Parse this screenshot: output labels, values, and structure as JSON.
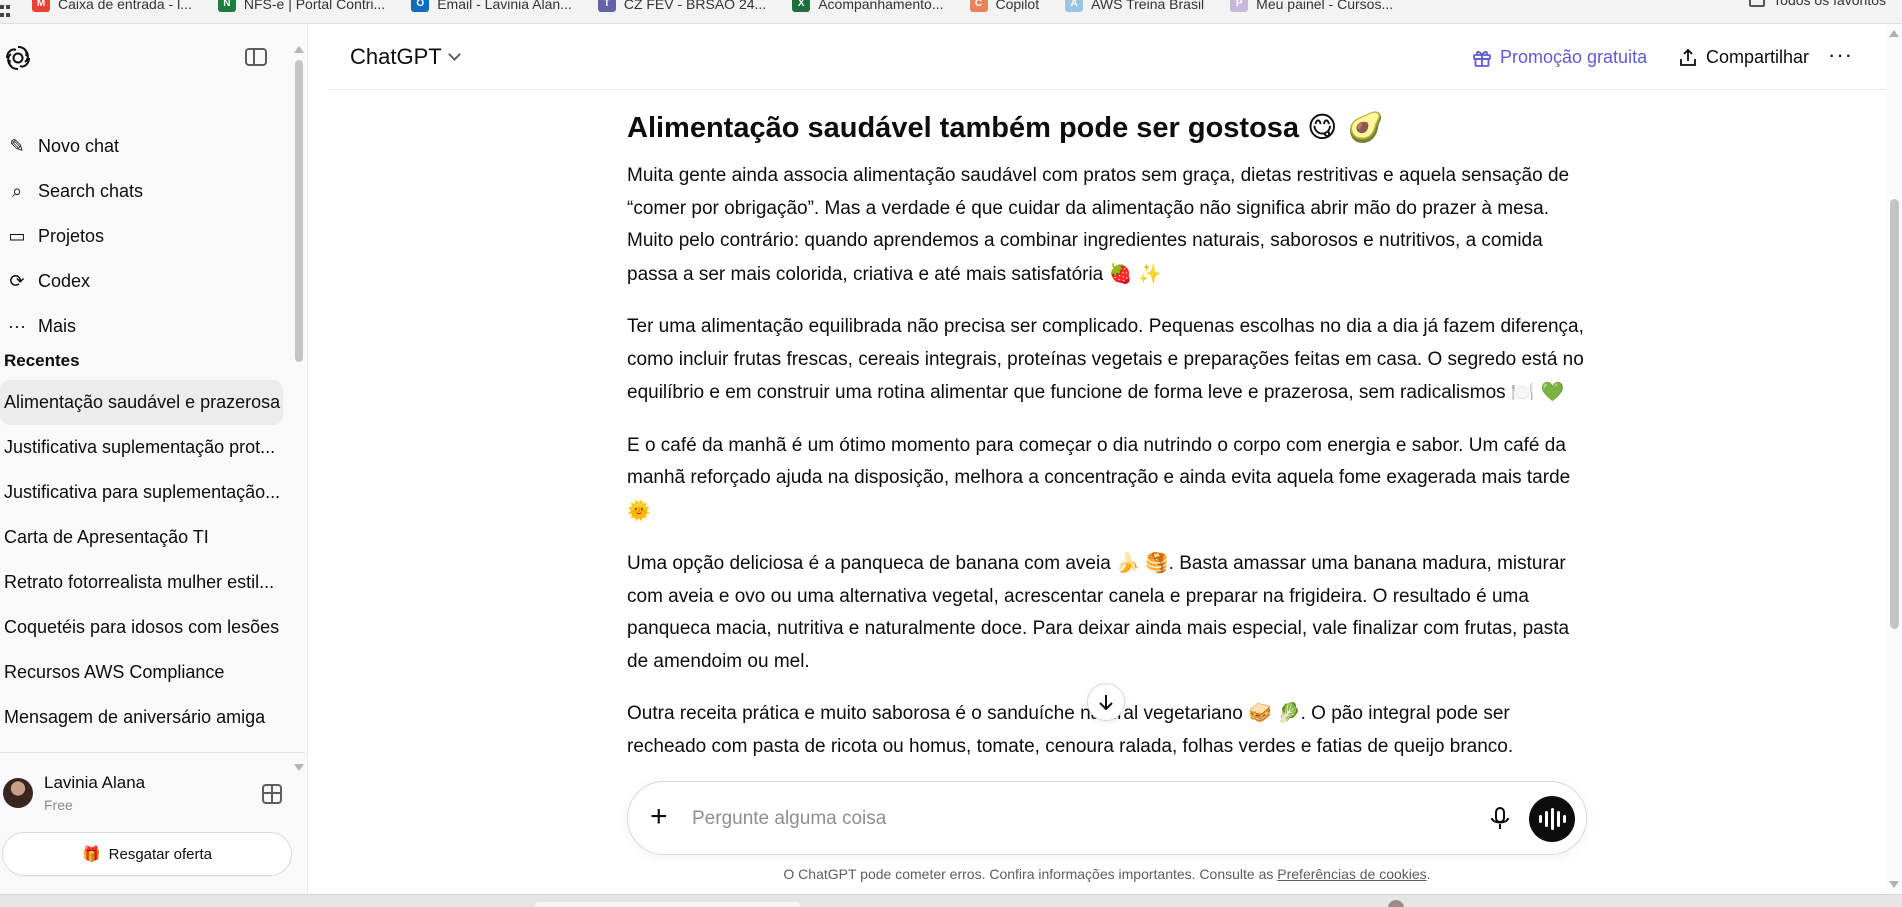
{
  "bookmarks": {
    "items": [
      {
        "label": "Caixa de entrada - l...",
        "icon": "gmail-icon",
        "color": "#ea4335",
        "glyph": "M"
      },
      {
        "label": "NFS-e | Portal Contri...",
        "icon": "nfse-icon",
        "color": "#1a7f3c",
        "glyph": "N"
      },
      {
        "label": "Email - Lavinia Alan...",
        "icon": "outlook-icon",
        "color": "#0f6cbd",
        "glyph": "O"
      },
      {
        "label": "CZ FEV - BRSAO 24...",
        "icon": "teams-icon",
        "color": "#6264a7",
        "glyph": "T"
      },
      {
        "label": "Acompanhamento...",
        "icon": "excel-icon",
        "color": "#1d6f42",
        "glyph": "X"
      },
      {
        "label": "Copilot",
        "icon": "copilot-icon",
        "color": "#e8835a",
        "glyph": "C"
      },
      {
        "label": "AWS Treina Brasil",
        "icon": "aws-icon",
        "color": "#9ac4e0",
        "glyph": "A"
      },
      {
        "label": "Meu painel - Cursos...",
        "icon": "courses-icon",
        "color": "#c7b7d9",
        "glyph": "P"
      }
    ],
    "all_favorites": "Todos os favoritos"
  },
  "sidebar": {
    "nav": [
      {
        "label": "Novo chat",
        "icon": "new-chat-icon",
        "glyph": "✎"
      },
      {
        "label": "Search chats",
        "icon": "search-icon",
        "glyph": "⌕"
      },
      {
        "label": "Projetos",
        "icon": "projects-icon",
        "glyph": "▭"
      },
      {
        "label": "Codex",
        "icon": "codex-icon",
        "glyph": "⟳"
      },
      {
        "label": "Mais",
        "icon": "more-dots-icon",
        "glyph": "···"
      }
    ],
    "section_title": "Recentes",
    "chats": [
      "Alimentação saudável e prazerosa",
      "Justificativa suplementação prot...",
      "Justificativa para suplementação...",
      "Carta de Apresentação TI",
      "Retrato fotorrealista mulher estil...",
      "Coquetéis para idosos com lesões",
      "Recursos AWS Compliance",
      "Mensagem de aniversário amiga"
    ],
    "user": {
      "name": "Lavinia Alana",
      "plan": "Free"
    },
    "offer_button": "Resgatar oferta"
  },
  "header": {
    "model": "ChatGPT",
    "promo": "Promoção gratuita",
    "share": "Compartilhar",
    "more": "···"
  },
  "article": {
    "title": "Alimentação saudável também pode ser gostosa",
    "title_emojis": "😋 🥑",
    "paragraphs": [
      {
        "text": "Muita gente ainda associa alimentação saudável com pratos sem graça, dietas restritivas e aquela sensação de “comer por obrigação”. Mas a verdade é que cuidar da alimentação não significa abrir mão do prazer à mesa. Muito pelo contrário: quando aprendemos a combinar ingredientes naturais, saborosos e nutritivos, a comida passa a ser mais colorida, criativa e até mais satisfatória",
        "emoji": "🍓 ✨"
      },
      {
        "text": "Ter uma alimentação equilibrada não precisa ser complicado. Pequenas escolhas no dia a dia já fazem diferença, como incluir frutas frescas, cereais integrais, proteínas vegetais e preparações feitas em casa. O segredo está no equilíbrio e em construir uma rotina alimentar que funcione de forma leve e prazerosa, sem radicalismos",
        "emoji": "🍽️ 💚"
      },
      {
        "text": "E o café da manhã é um ótimo momento para começar o dia nutrindo o corpo com energia e sabor. Um café da manhã reforçado ajuda na disposição, melhora a concentração e ainda evita aquela fome exagerada mais tarde",
        "emoji": "🌞"
      },
      {
        "text": "Uma opção deliciosa é a panqueca de banana com aveia 🍌 🥞. Basta amassar uma banana madura, misturar com aveia e ovo ou uma alternativa vegetal, acrescentar canela e preparar na frigideira. O resultado é uma panqueca macia, nutritiva e naturalmente doce. Para deixar ainda mais especial, vale finalizar com frutas, pasta de amendoim ou mel.",
        "emoji": ""
      },
      {
        "text": "Outra receita prática e muito saborosa é o sanduíche natural vegetariano 🥪 🥬. O pão integral pode ser recheado com pasta de ricota ou homus, tomate, cenoura ralada, folhas verdes e fatias de queijo branco.",
        "emoji": ""
      }
    ]
  },
  "composer": {
    "placeholder": "Pergunte alguma coisa"
  },
  "footer": {
    "disclaimer": "O ChatGPT pode cometer erros. Confira informações importantes. Consulte as",
    "link": "Preferências de cookies",
    "end": "."
  },
  "colors": {
    "accent": "#5e5bd8",
    "sidebar_bg": "#f9f9f9",
    "active_chat_bg": "#ececec"
  }
}
